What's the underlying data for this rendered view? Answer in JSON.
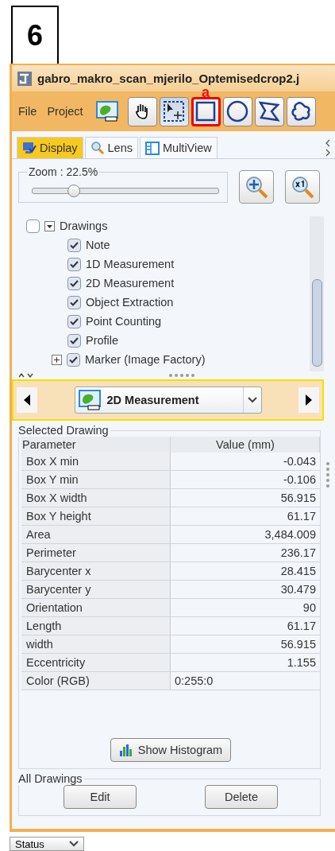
{
  "step_label": "6",
  "window": {
    "title": "gabro_makro_scan_mjerilo_Optemisedcrop2.j"
  },
  "menu": [
    "File",
    "Project"
  ],
  "tools": [
    {
      "kind": "app",
      "selected": false
    },
    {
      "kind": "hand",
      "selected": false
    },
    {
      "kind": "select",
      "selected": true
    },
    {
      "kind": "rectangle",
      "selected": false,
      "annotation": "a"
    },
    {
      "kind": "ellipse",
      "selected": false
    },
    {
      "kind": "polygon",
      "selected": false
    },
    {
      "kind": "freehand",
      "selected": false
    }
  ],
  "tabs": [
    {
      "label": "Display",
      "kind": "display",
      "selected": true
    },
    {
      "label": "Lens",
      "kind": "lens",
      "selected": false
    },
    {
      "label": "MultiView",
      "kind": "multiview",
      "selected": false
    }
  ],
  "zoom": {
    "label": "Zoom : 22.5%",
    "level": 0.22
  },
  "tree": {
    "label": "Drawings",
    "checked": false,
    "expanded": true,
    "children": [
      {
        "label": "Note",
        "checked": true
      },
      {
        "label": "1D Measurement",
        "checked": true
      },
      {
        "label": "2D Measurement",
        "checked": true
      },
      {
        "label": "Object Extraction",
        "checked": true
      },
      {
        "label": "Point Counting",
        "checked": true
      },
      {
        "label": "Profile",
        "checked": true
      },
      {
        "label": "Marker (Image Factory)",
        "checked": true,
        "expandable": true
      }
    ]
  },
  "drawing_type": {
    "value": "2D Measurement"
  },
  "selected_drawing": {
    "title": "Selected Drawing",
    "columns": [
      "Parameter",
      "Value (mm)"
    ],
    "rows": [
      {
        "parameter": "Box X min",
        "value": "-0.043",
        "kind": "number"
      },
      {
        "parameter": "Box Y min",
        "value": "-0.106",
        "kind": "number"
      },
      {
        "parameter": "Box X width",
        "value": "56.915",
        "kind": "number"
      },
      {
        "parameter": "Box Y height",
        "value": "61.17",
        "kind": "number"
      },
      {
        "parameter": "Area",
        "value": "3,484.009",
        "kind": "number"
      },
      {
        "parameter": "Perimeter",
        "value": "236.17",
        "kind": "number"
      },
      {
        "parameter": "Barycenter x",
        "value": "28.415",
        "kind": "number"
      },
      {
        "parameter": "Barycenter y",
        "value": "30.479",
        "kind": "number"
      },
      {
        "parameter": "Orientation",
        "value": "90",
        "kind": "number"
      },
      {
        "parameter": "Length",
        "value": "61.17",
        "kind": "number"
      },
      {
        "parameter": "width",
        "value": "56.915",
        "kind": "number"
      },
      {
        "parameter": "Eccentricity",
        "value": "1.155",
        "kind": "number"
      },
      {
        "parameter": "Color (RGB)",
        "value": "0:255:0",
        "kind": "text"
      }
    ],
    "button": "Show Histogram"
  },
  "all_drawings": {
    "title": "All Drawings",
    "buttons": [
      "Edit",
      "Delete"
    ]
  },
  "status": {
    "value": "Status"
  }
}
